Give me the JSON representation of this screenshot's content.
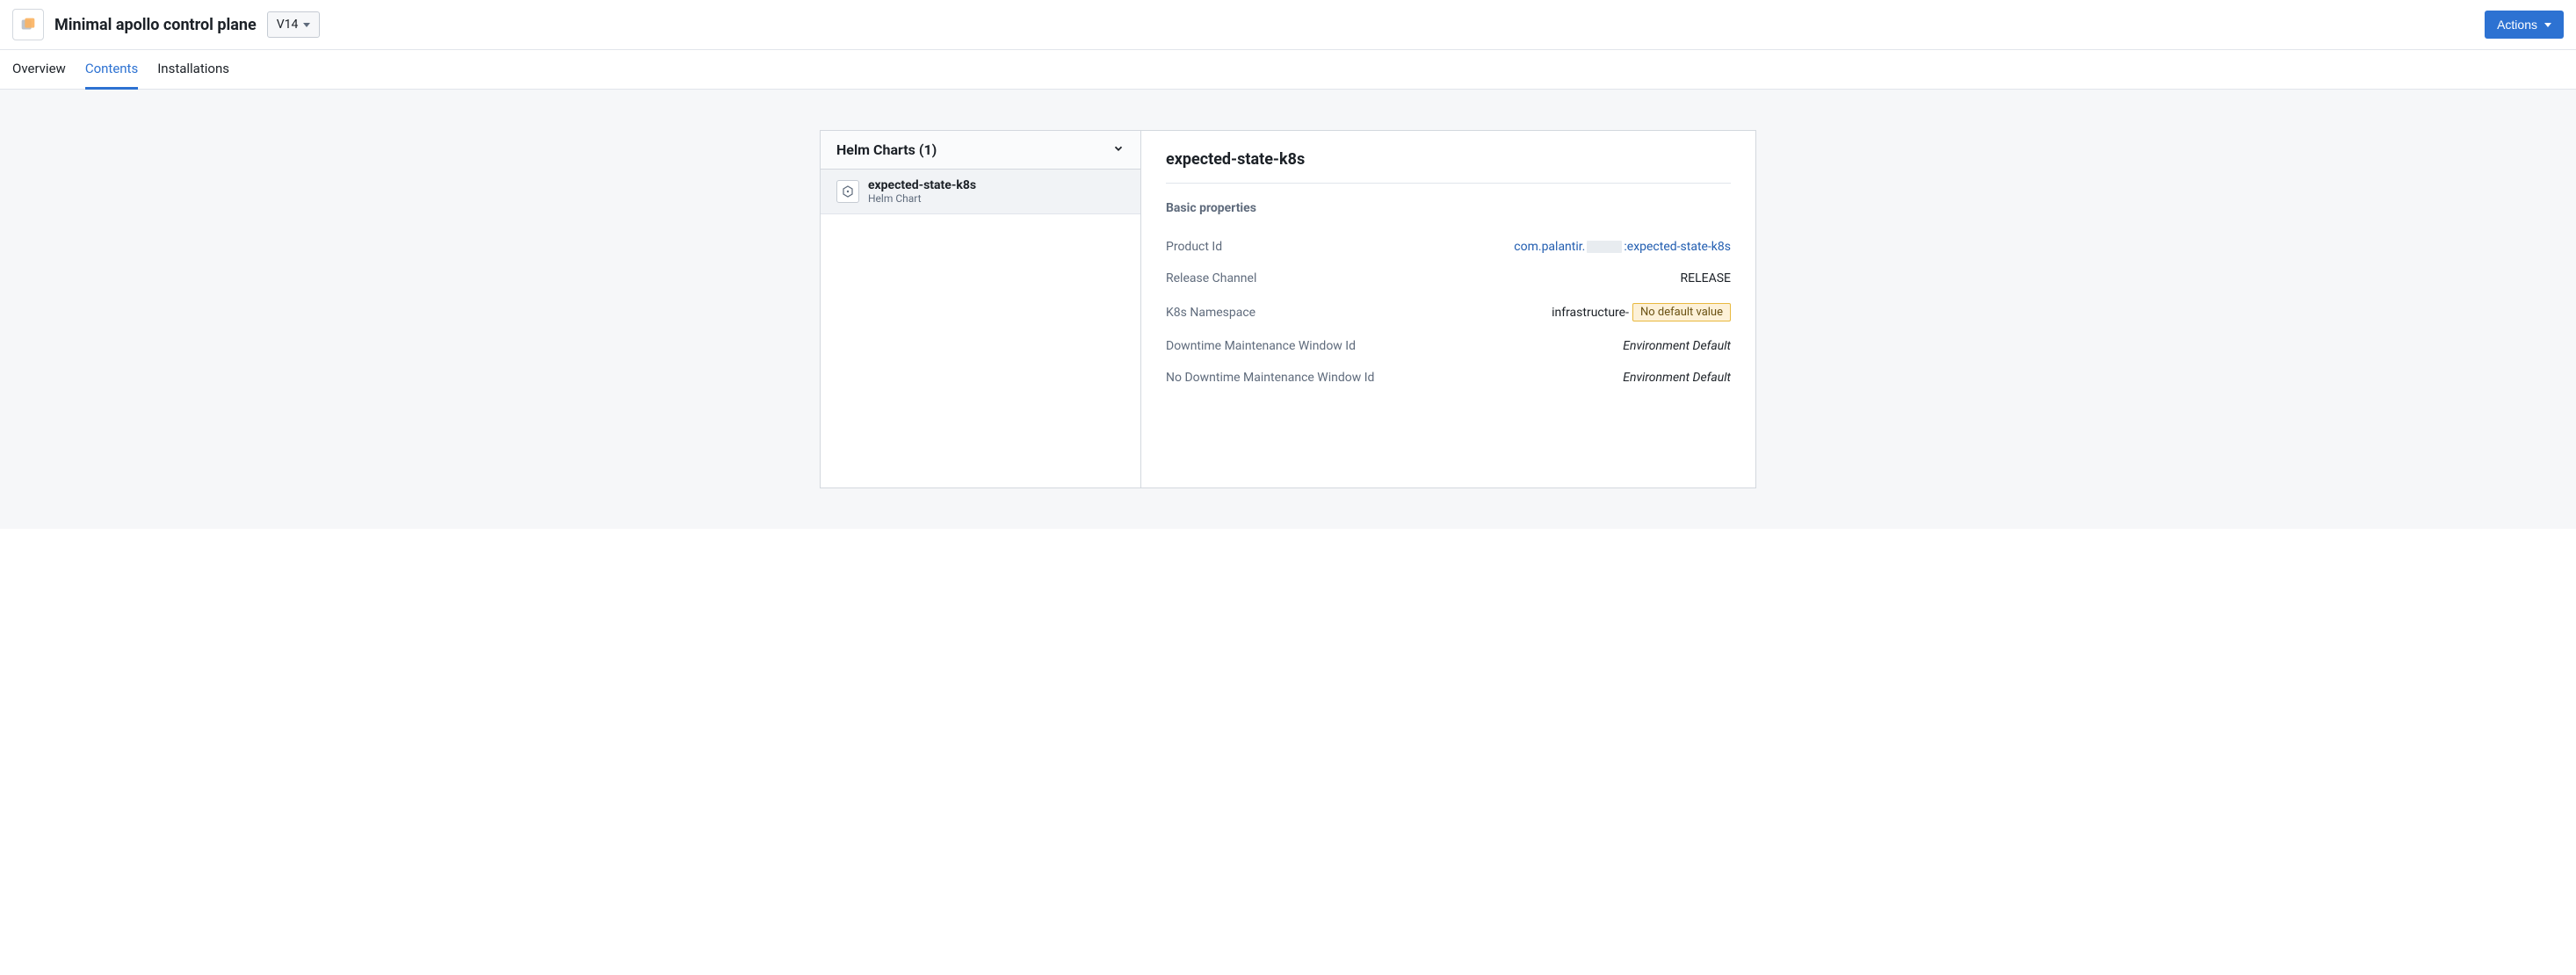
{
  "header": {
    "title": "Minimal apollo control plane",
    "version": "V14",
    "actions_label": "Actions"
  },
  "tabs": [
    {
      "label": "Overview",
      "active": false
    },
    {
      "label": "Contents",
      "active": true
    },
    {
      "label": "Installations",
      "active": false
    }
  ],
  "sidebar": {
    "section_title": "Helm Charts (1)",
    "items": [
      {
        "title": "expected-state-k8s",
        "subtitle": "Helm Chart"
      }
    ]
  },
  "detail": {
    "title": "expected-state-k8s",
    "section_title": "Basic properties",
    "properties": {
      "product_id": {
        "label": "Product Id",
        "value_prefix": "com.palantir.",
        "value_suffix": ":expected-state-k8s"
      },
      "release_channel": {
        "label": "Release Channel",
        "value": "RELEASE"
      },
      "k8s_namespace": {
        "label": "K8s Namespace",
        "value": "infrastructure-",
        "badge": "No default value"
      },
      "downtime_window": {
        "label": "Downtime Maintenance Window Id",
        "value": "Environment Default"
      },
      "no_downtime_window": {
        "label": "No Downtime Maintenance Window Id",
        "value": "Environment Default"
      }
    }
  }
}
